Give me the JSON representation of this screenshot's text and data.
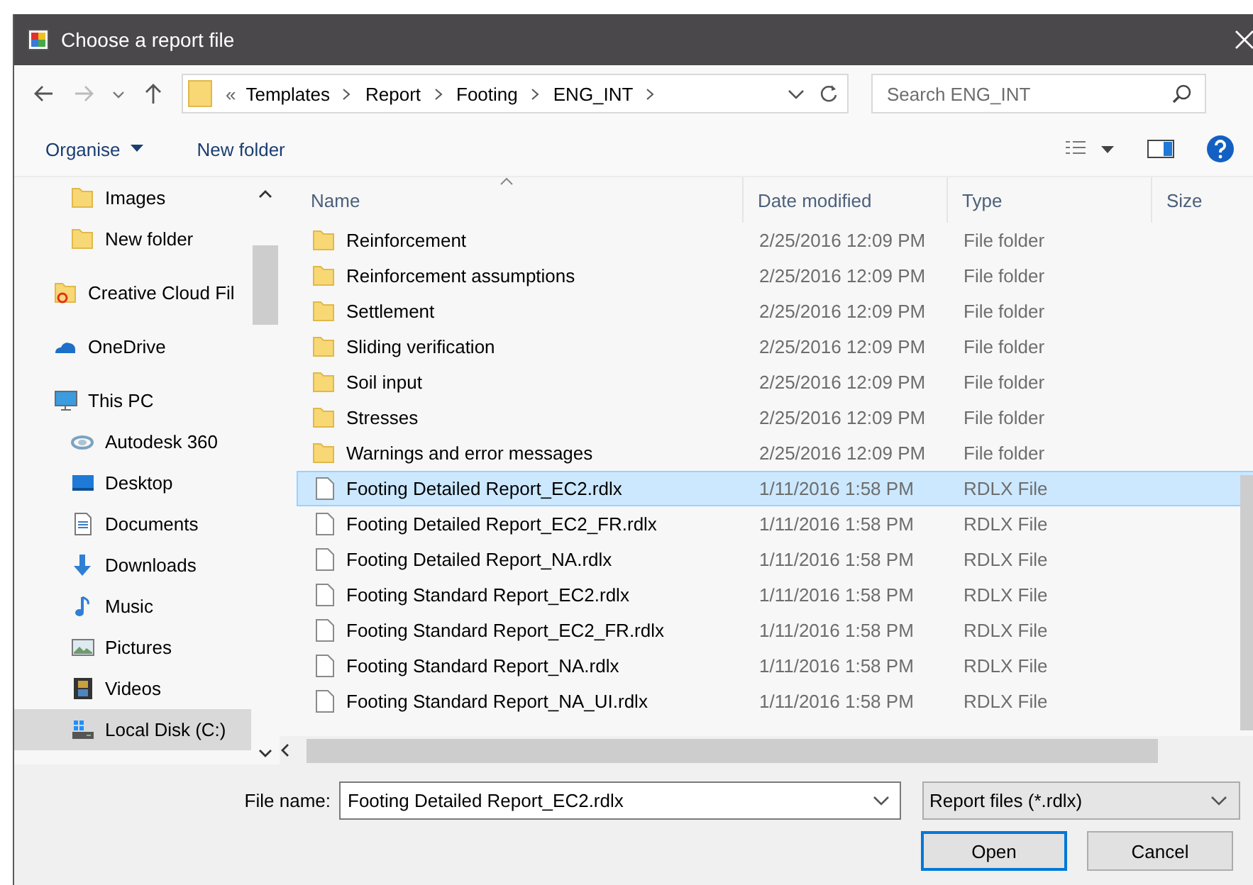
{
  "window": {
    "title": "Choose a report file"
  },
  "address_bar": {
    "overflow": "«",
    "path": [
      "Templates",
      "Report",
      "Footing",
      "ENG_INT"
    ]
  },
  "search": {
    "placeholder": "Search ENG_INT"
  },
  "toolbar": {
    "organise": "Organise",
    "new_folder": "New folder"
  },
  "sidebar": {
    "items": [
      {
        "label": "Images",
        "kind": "subfolder",
        "selected": false
      },
      {
        "label": "New folder",
        "kind": "subfolder",
        "selected": false
      },
      {
        "label": "Creative Cloud Fil",
        "kind": "cloudfiles",
        "selected": false
      },
      {
        "label": "OneDrive",
        "kind": "onedrive",
        "selected": false
      },
      {
        "label": "This PC",
        "kind": "pc",
        "selected": false,
        "children": [
          {
            "label": "Autodesk 360",
            "kind": "a360",
            "selected": false
          },
          {
            "label": "Desktop",
            "kind": "desktop",
            "selected": false
          },
          {
            "label": "Documents",
            "kind": "documents",
            "selected": false
          },
          {
            "label": "Downloads",
            "kind": "downloads",
            "selected": false
          },
          {
            "label": "Music",
            "kind": "music",
            "selected": false
          },
          {
            "label": "Pictures",
            "kind": "pictures",
            "selected": false
          },
          {
            "label": "Videos",
            "kind": "videos",
            "selected": false
          },
          {
            "label": "Local Disk (C:)",
            "kind": "disk",
            "selected": true
          }
        ]
      }
    ]
  },
  "table": {
    "columns": [
      "Name",
      "Date modified",
      "Type",
      "Size"
    ],
    "rows": [
      {
        "name": "Reinforcement",
        "date": "2/25/2016 12:09 PM",
        "type": "File folder",
        "kind": "folder",
        "selected": false
      },
      {
        "name": "Reinforcement assumptions",
        "date": "2/25/2016 12:09 PM",
        "type": "File folder",
        "kind": "folder",
        "selected": false
      },
      {
        "name": "Settlement",
        "date": "2/25/2016 12:09 PM",
        "type": "File folder",
        "kind": "folder",
        "selected": false
      },
      {
        "name": "Sliding verification",
        "date": "2/25/2016 12:09 PM",
        "type": "File folder",
        "kind": "folder",
        "selected": false
      },
      {
        "name": "Soil input",
        "date": "2/25/2016 12:09 PM",
        "type": "File folder",
        "kind": "folder",
        "selected": false
      },
      {
        "name": "Stresses",
        "date": "2/25/2016 12:09 PM",
        "type": "File folder",
        "kind": "folder",
        "selected": false
      },
      {
        "name": "Warnings and error messages",
        "date": "2/25/2016 12:09 PM",
        "type": "File folder",
        "kind": "folder",
        "selected": false
      },
      {
        "name": "Footing Detailed Report_EC2.rdlx",
        "date": "1/11/2016 1:58 PM",
        "type": "RDLX File",
        "kind": "file",
        "selected": true
      },
      {
        "name": "Footing Detailed Report_EC2_FR.rdlx",
        "date": "1/11/2016 1:58 PM",
        "type": "RDLX File",
        "kind": "file",
        "selected": false
      },
      {
        "name": "Footing Detailed Report_NA.rdlx",
        "date": "1/11/2016 1:58 PM",
        "type": "RDLX File",
        "kind": "file",
        "selected": false
      },
      {
        "name": "Footing Standard Report_EC2.rdlx",
        "date": "1/11/2016 1:58 PM",
        "type": "RDLX File",
        "kind": "file",
        "selected": false
      },
      {
        "name": "Footing Standard Report_EC2_FR.rdlx",
        "date": "1/11/2016 1:58 PM",
        "type": "RDLX File",
        "kind": "file",
        "selected": false
      },
      {
        "name": "Footing Standard Report_NA.rdlx",
        "date": "1/11/2016 1:58 PM",
        "type": "RDLX File",
        "kind": "file",
        "selected": false
      },
      {
        "name": "Footing Standard Report_NA_UI.rdlx",
        "date": "1/11/2016 1:58 PM",
        "type": "RDLX File",
        "kind": "file",
        "selected": false
      }
    ]
  },
  "file_name": {
    "label": "File name:",
    "value": "Footing Detailed Report_EC2.rdlx"
  },
  "file_type": {
    "value": "Report files (*.rdlx)"
  },
  "buttons": [
    {
      "label": "Open",
      "kind": "primary"
    },
    {
      "label": "Cancel",
      "kind": "normal"
    }
  ]
}
